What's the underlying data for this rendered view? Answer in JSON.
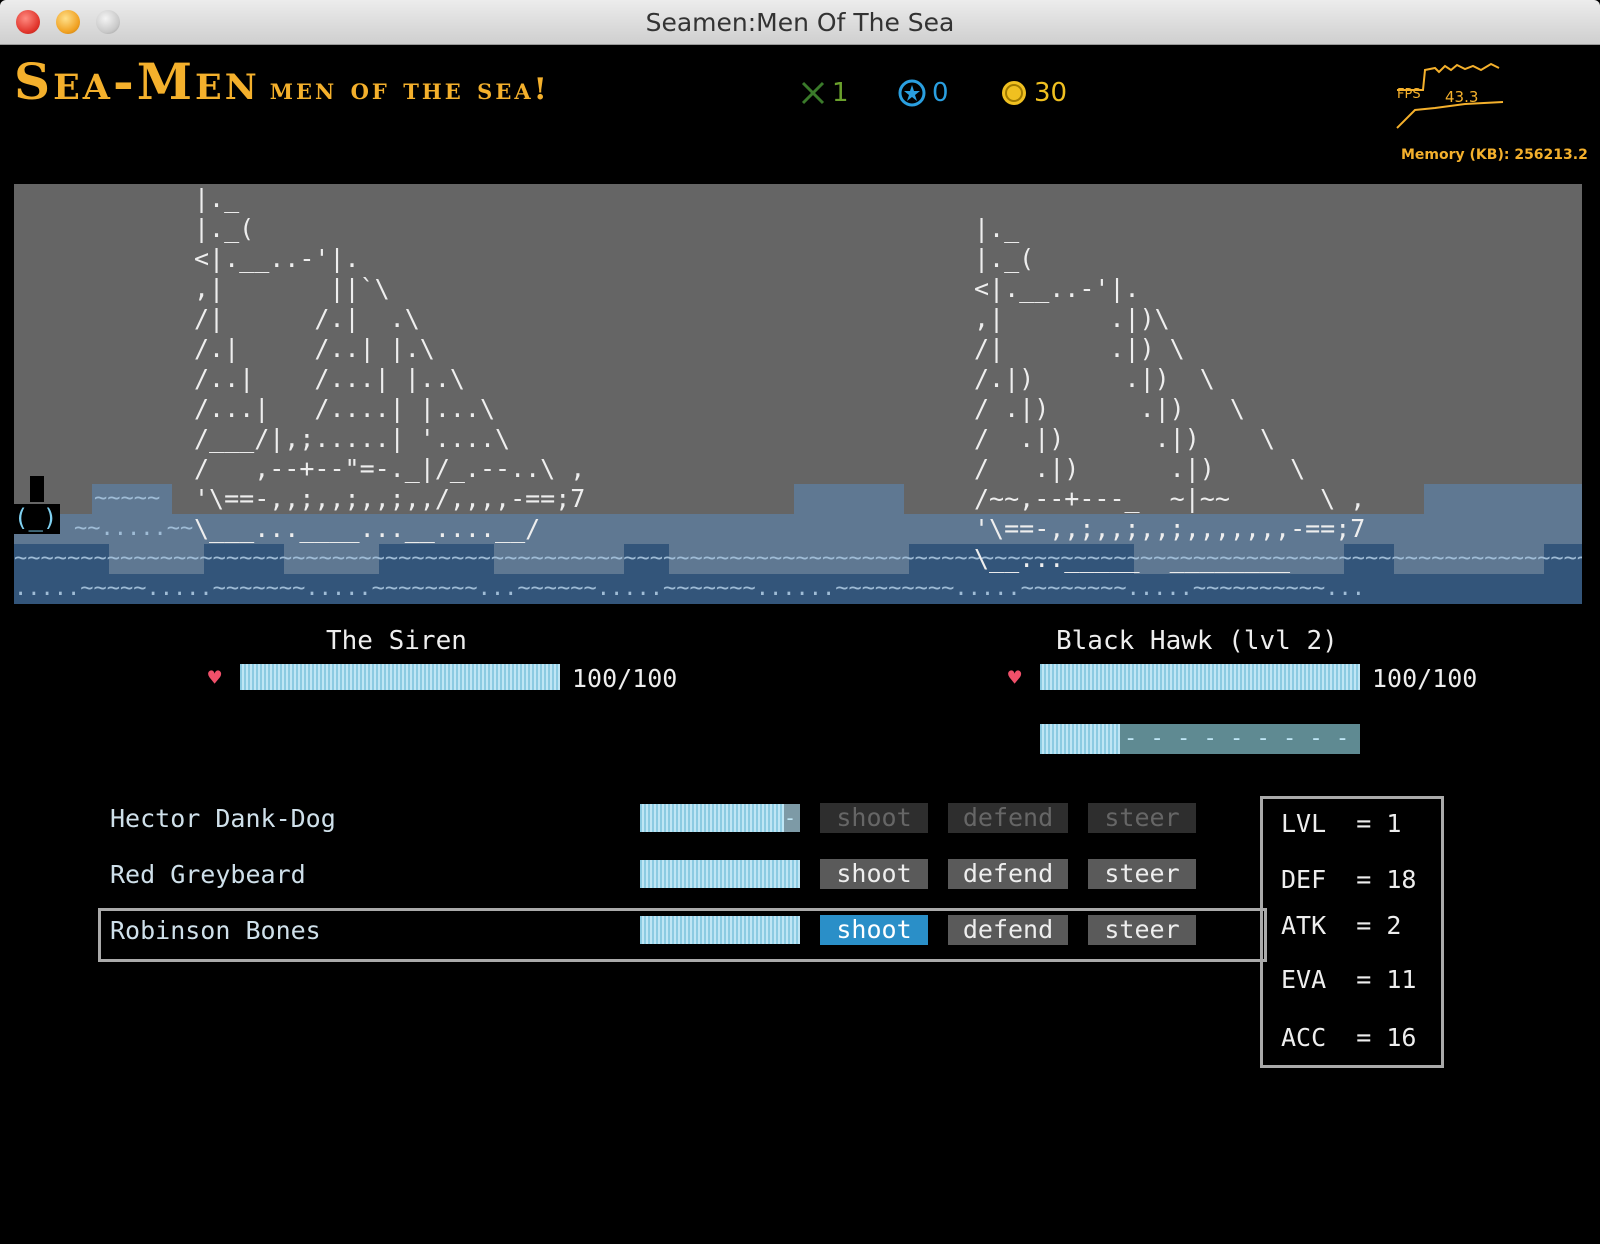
{
  "window": {
    "title": "Seamen:Men Of The Sea"
  },
  "header": {
    "logo_big": "Sea-Men",
    "logo_small": "men of the sea!",
    "swords_count": "1",
    "stars_count": "0",
    "coins_count": "30",
    "fps_label": "FPS",
    "fps_value": "43.3",
    "memory": "Memory (KB): 256213.2",
    "colors": {
      "accent": "#f4b02c",
      "swords": "#6aa02c",
      "stars": "#2a9fe0",
      "coins": "#f0c020"
    }
  },
  "scene": {
    "player_ship": "|._\n|._(\n<|.__..-'|.\n,|       ||`\\\n/|      /.|  .\\\n/.|     /..| |.\\\n/..|    /...| |..\\\n/...|   /....| |...\\\n/___/|,;.....| '....\\\n/   ,--+--\"=-._|/_.--..\\ ,\n'\\==-,,;,,;,,;,,/,,,,-==;7\n\\___...____...__....__/",
    "enemy_ship": "|._\n|._(\n<|.__..-'|.\n,|       .|)\\\n/|       .|) \\\n/.|)      .|)  \\\n/ .|)      .|)   \\\n/  .|)      .|)    \\\n/   .|)      .|)     \\\n/~~,--+---_  ~|~~      \\ ,\n'\\==-,,;,,;,,;,,,,,,,-==;7\n\\__..._____  ________"
  },
  "player": {
    "name": "The Siren",
    "hp": "100/100",
    "hp_fraction": 1.0
  },
  "enemy": {
    "name": "Black Hawk (lvl 2)",
    "hp": "100/100",
    "hp_fraction": 1.0,
    "charge_fraction": 0.25
  },
  "crew": [
    {
      "name": "Hector Dank-Dog",
      "stamina_fraction": 0.9,
      "shoot": "shoot",
      "defend": "defend",
      "steer": "steer",
      "state": "dim"
    },
    {
      "name": "Red Greybeard",
      "stamina_fraction": 1.0,
      "shoot": "shoot",
      "defend": "defend",
      "steer": "steer",
      "state": "normal"
    },
    {
      "name": "Robinson Bones",
      "stamina_fraction": 1.0,
      "shoot": "shoot",
      "defend": "defend",
      "steer": "steer",
      "state": "selected"
    }
  ],
  "stats": {
    "lvl": "LVL  = 1",
    "def": "DEF  = 18",
    "atk": "ATK  = 2",
    "eva": "EVA  = 11",
    "acc": "ACC  = 16"
  }
}
